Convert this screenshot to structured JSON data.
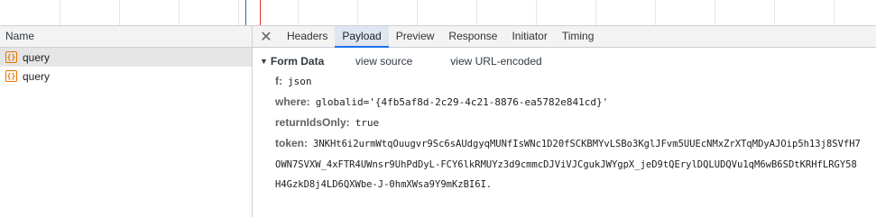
{
  "left_pane": {
    "header": "Name",
    "requests": [
      {
        "name": "query",
        "selected": true
      },
      {
        "name": "query",
        "selected": false
      }
    ]
  },
  "tabs": [
    "Headers",
    "Payload",
    "Preview",
    "Response",
    "Initiator",
    "Timing"
  ],
  "active_tab": "Payload",
  "form_data": {
    "title": "Form Data",
    "view_source": "view source",
    "view_url_encoded": "view URL-encoded",
    "fields": [
      {
        "key": "f:",
        "value": "json"
      },
      {
        "key": "where:",
        "value": "globalid='{4fb5af8d-2c29-4c21-8876-ea5782e841cd}'"
      },
      {
        "key": "returnIdsOnly:",
        "value": "true"
      }
    ],
    "token": {
      "key": "token:",
      "value": "3NKHt6i2urmWtqOuugvr9Sc6sAUdgyqMUNfIsWNc1D20fSCKBMYvLSBo3KglJFvm5UUEcNMxZrXTqMDyAJOip5h13j8SVfH7OWN7SVXW_4xFTR4UWnsr9UhPdDyL-FCY6lkRMUYz3d9cmmcDJViVJCgukJWYgpX_jeD9tQErylDQLUDQVu1qM6wB6SDtKRHfLRGY58H4GzkD8j4LD6QXWbe-J-0hmXWsa9Y9mKzBI6I."
    }
  },
  "colors": {
    "accent": "#1a73e8",
    "request_icon": "#e37400",
    "timeline_blue": "#3b5bd9",
    "timeline_red": "#d93025"
  }
}
